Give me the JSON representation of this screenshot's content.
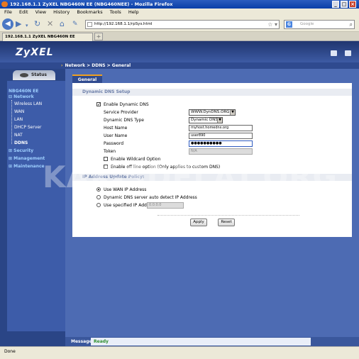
{
  "window": {
    "title": "192.168.1.1 ZyXEL NBG460N EE (NBG460NEE) - Mozilla Firefox"
  },
  "menu": [
    "File",
    "Edit",
    "View",
    "History",
    "Bookmarks",
    "Tools",
    "Help"
  ],
  "address": {
    "url": "http://192.168.1.1/rpSys.html",
    "search_placeholder": "Google"
  },
  "tab": {
    "label": "192.168.1.1 ZyXEL NBG460N EE (NBG4..."
  },
  "brand": {
    "logo": "ZyXEL"
  },
  "breadcrumb": "Network > DDNS > General",
  "sidebar": {
    "status_tab": "Status",
    "device": "NBG460N EE",
    "network": "Network",
    "items": [
      "Wireless LAN",
      "WAN",
      "LAN",
      "DHCP Server",
      "NAT",
      "DDNS"
    ],
    "sections": [
      "Security",
      "Management",
      "Maintenance"
    ]
  },
  "tabs": {
    "general": "General"
  },
  "ddns": {
    "section_title": "Dynamic DNS Setup",
    "enable_label": "Enable Dynamic DNS",
    "enable_checked": true,
    "provider_label": "Service Provider",
    "provider_value": "WWW.DynDNS.ORG",
    "type_label": "Dynamic DNS Type",
    "type_value": "Dynamic DNS",
    "host_label": "Host Name",
    "host_value": "myhost.homedns.org",
    "user_label": "User Name",
    "user_value": "user890",
    "password_label": "Password",
    "password_value": "●●●●●●●●●●",
    "token_label": "Token",
    "token_value": "N/A",
    "wildcard_label": "Enable Wildcard Option",
    "offline_label": "Enable off line option (Only applies to custom DNS)"
  },
  "policy": {
    "section_title": "IP Address Update Policy:",
    "opt_wan": "Use WAN IP Address",
    "opt_auto": "Dynamic DNS server auto detect IP Address",
    "opt_specified": "Use specified IP Address",
    "specified_value": "0.0.0.0",
    "selected": "wan"
  },
  "buttons": {
    "apply": "Apply",
    "reset": "Reset"
  },
  "message": {
    "label": "Message",
    "value": "Ready"
  },
  "watermark": "KAK-SDELAT.ORG",
  "statusbar": "Done"
}
